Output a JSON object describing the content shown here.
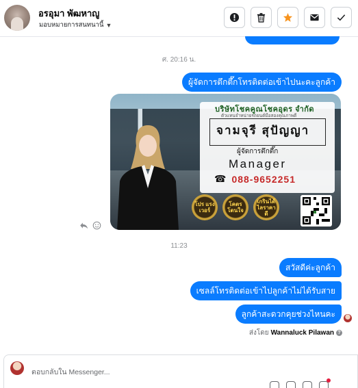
{
  "header": {
    "contact_name": "อรอุมา พัฒหาญู",
    "assigned_label": "มอบหมายการสนทนานี้",
    "actions": [
      "alert-icon",
      "trash-icon",
      "star-icon",
      "envelope-icon",
      "check-icon"
    ]
  },
  "conversation": {
    "timestamp_1": "ศ. 20:16 น.",
    "message_1": "ผู้จัดการตึกตึ๊กโทรติดต่อเข้าไปนะคะลูกค้า",
    "timestamp_2": "11:23",
    "messages_2": [
      "สวัสดีค่ะลูกค้า",
      "เซลล์โทรติดต่อเข้าไปลูกค้าไม่ได้รับสาย",
      "ลูกค้าสะดวกคุยช่วงไหนคะ"
    ],
    "sent_by_prefix": "ส่งโดย",
    "sent_by_name": "Wannaluck Pilawan"
  },
  "image_card": {
    "company": "บริษัทโชคคูณโชคอุดร จำกัด",
    "company_sub": "ตัวแทนจำหน่ายรถยนต์มือสองคุณภาพดี",
    "name": "จามจุรี สุปัญญา",
    "title": "ผู้จัดการตึกตึ๊ก",
    "role": "Manager",
    "phone": "088-9652251",
    "badges": [
      "โปร แรง เวอร์",
      "โคตร โดนใจ",
      "เกรินได้ ไลราคาดี"
    ]
  },
  "composer": {
    "placeholder": "ตอบกลับใน Messenger..."
  },
  "colors": {
    "bubble": "#0a7cff",
    "accent_star": "#f7931e",
    "phone": "#c62828"
  }
}
